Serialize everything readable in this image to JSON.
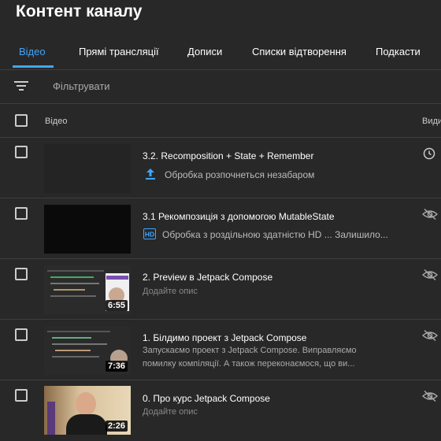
{
  "page": {
    "title": "Контент каналу"
  },
  "tabs": [
    {
      "label": "Відео"
    },
    {
      "label": "Прямі трансляції"
    },
    {
      "label": "Дописи"
    },
    {
      "label": "Списки відтворення"
    },
    {
      "label": "Подкасти"
    }
  ],
  "filter": {
    "placeholder": "Фільтрувати"
  },
  "table": {
    "header": {
      "video": "Відео",
      "visibility": "Видимість"
    }
  },
  "videos": [
    {
      "title": "3.2. Recomposition + State + Remember",
      "status": "Обробка розпочнеться незабаром",
      "status_icon": "upload-icon",
      "visibility_icon": "clock-icon"
    },
    {
      "title": "3.1 Рекомпозиція з допомогою MutableState",
      "status": "Обробка з роздільною здатністю HD ... Залишило...",
      "status_icon": "hd-icon",
      "visibility_icon": "eye-off-icon"
    },
    {
      "title": "2. Preview в Jetpack Compose",
      "description": "Додайте опис",
      "duration": "6:55",
      "visibility_icon": "eye-off-icon"
    },
    {
      "title": "1. Білдимо проект з Jetpack Compose",
      "description": "Запускаємо проект з Jetpack Compose. Виправляємо помилку компіляції. А також переконаємося, що ви...",
      "duration": "7:36",
      "visibility_icon": "eye-off-icon"
    },
    {
      "title": "0. Про курс Jetpack Compose",
      "description": "Додайте опис",
      "duration": "2:26",
      "visibility_icon": "eye-off-icon"
    }
  ]
}
